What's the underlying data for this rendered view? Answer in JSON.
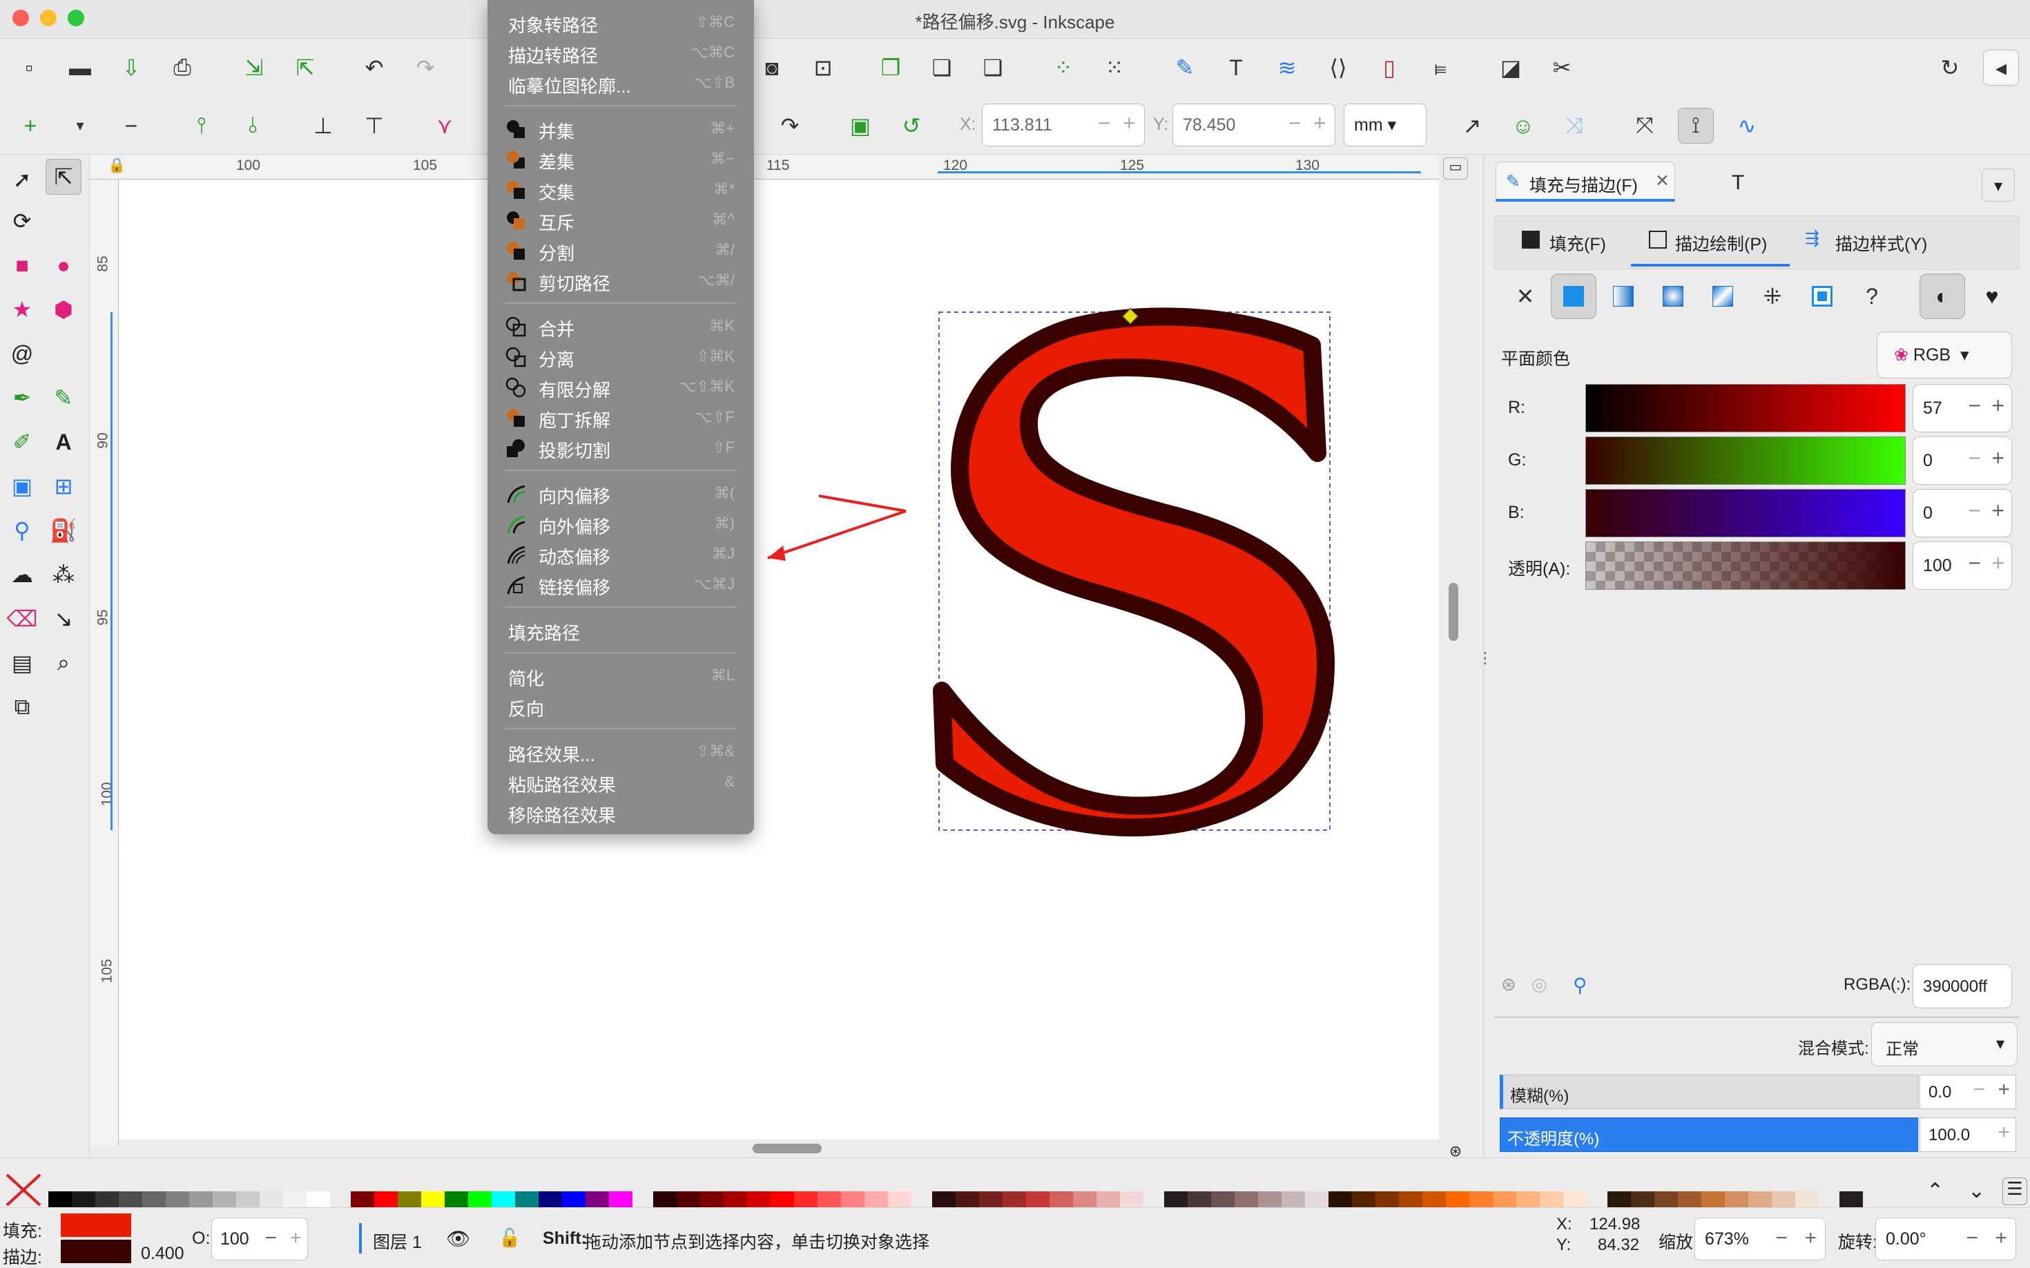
{
  "window": {
    "title": "*路径偏移.svg - Inkscape"
  },
  "toolbar": {
    "x_label": "X:",
    "x_value": "113.811",
    "y_label": "Y:",
    "y_value": "78.450",
    "unit": "mm"
  },
  "ruler": {
    "top_ticks": [
      "100",
      "105",
      "115",
      "120",
      "125",
      "130"
    ],
    "left_ticks": [
      "85",
      "90",
      "95",
      "100",
      "105"
    ]
  },
  "menu": {
    "items": [
      {
        "label": "对象转路径",
        "shortcut": "⇧⌘C"
      },
      {
        "label": "描边转路径",
        "shortcut": "⌥⌘C"
      },
      {
        "label": "临摹位图轮廓...",
        "shortcut": "⌥⇧B"
      },
      {
        "label": "并集",
        "shortcut": "⌘+"
      },
      {
        "label": "差集",
        "shortcut": "⌘−"
      },
      {
        "label": "交集",
        "shortcut": "⌘*"
      },
      {
        "label": "互斥",
        "shortcut": "⌘^"
      },
      {
        "label": "分割",
        "shortcut": "⌘/"
      },
      {
        "label": "剪切路径",
        "shortcut": "⌥⌘/"
      },
      {
        "label": "合并",
        "shortcut": "⌘K"
      },
      {
        "label": "分离",
        "shortcut": "⇧⌘K"
      },
      {
        "label": "有限分解",
        "shortcut": "⌥⇧⌘K"
      },
      {
        "label": "庖丁拆解",
        "shortcut": "⌥⇧F"
      },
      {
        "label": "投影切割",
        "shortcut": "⇧F"
      },
      {
        "label": "向内偏移",
        "shortcut": "⌘("
      },
      {
        "label": "向外偏移",
        "shortcut": "⌘)"
      },
      {
        "label": "动态偏移",
        "shortcut": "⌘J"
      },
      {
        "label": "链接偏移",
        "shortcut": "⌥⌘J"
      },
      {
        "label": "填充路径",
        "shortcut": ""
      },
      {
        "label": "简化",
        "shortcut": "⌘L"
      },
      {
        "label": "反向",
        "shortcut": ""
      },
      {
        "label": "路径效果...",
        "shortcut": "⇧⌘&"
      },
      {
        "label": "粘贴路径效果",
        "shortcut": "&"
      },
      {
        "label": "移除路径效果",
        "shortcut": ""
      }
    ]
  },
  "panel": {
    "tab_fill_stroke": "填充与描边(F)",
    "tab_text": "T",
    "subtab_fill": "填充(F)",
    "subtab_stroke_paint": "描边绘制(P)",
    "subtab_stroke_style": "描边样式(Y)",
    "flat_color_label": "平面颜色",
    "color_mode": "RGB",
    "r_label": "R:",
    "r_value": "57",
    "g_label": "G:",
    "g_value": "0",
    "b_label": "B:",
    "b_value": "0",
    "a_label": "透明(A):",
    "a_value": "100",
    "rgba_label": "RGBA(:):",
    "rgba_value": "390000ff",
    "blend_label": "混合模式:",
    "blend_value": "正常",
    "blur_label": "模糊(%)",
    "blur_value": "0.0",
    "opacity_label": "不透明度(%)",
    "opacity_value": "100.0"
  },
  "status": {
    "fill_label": "填充:",
    "stroke_label": "描边:",
    "stroke_width": "0.400",
    "o_label": "O:",
    "o_value": "100",
    "layer": "图层 1",
    "hint_key": "Shift:",
    "hint": "拖动添加节点到选择内容，单击切换对象选择",
    "x_label": "X:",
    "x_value": "124.98",
    "y_label": "Y:",
    "y_value": "84.32",
    "zoom_label": "缩放:",
    "zoom_value": "673%",
    "rotate_label": "旋转:",
    "rotate_value": "0.00°"
  },
  "colors": {
    "fill": "#e81c00",
    "stroke": "#390000",
    "accent": "#2a7ff0",
    "selection": "#3b8fe0"
  },
  "palette": [
    "#000000",
    "#1a1a1a",
    "#333333",
    "#4d4d4d",
    "#666666",
    "#808080",
    "#999999",
    "#b3b3b3",
    "#cccccc",
    "#e6e6e6",
    "#f2f2f2",
    "#ffffff",
    "#800000",
    "#ff0000",
    "#808000",
    "#ffff00",
    "#008000",
    "#00ff00",
    "#00ffff",
    "#008080",
    "#000080",
    "#0000ff",
    "#800080",
    "#ff00ff",
    "#2b0000",
    "#550000",
    "#800000",
    "#aa0000",
    "#d40000",
    "#ff0000",
    "#ff2a2a",
    "#ff5555",
    "#ff8080",
    "#ffaaaa",
    "#ffd5d5",
    "#280b0b",
    "#501616",
    "#782121",
    "#a02c2c",
    "#c83737",
    "#d35f5f",
    "#de8787",
    "#e9afaf",
    "#f4d7d7",
    "#241c1c",
    "#483737",
    "#6c5353",
    "#916f6f",
    "#ac9393",
    "#c8b7b7",
    "#e3dbdb",
    "#2b1100",
    "#552200",
    "#803300",
    "#aa4400",
    "#d45500",
    "#ff6600",
    "#ff7f2a",
    "#ff9955",
    "#ffb380",
    "#ffccaa",
    "#ffe6d5",
    "#28170b",
    "#502d16",
    "#784421",
    "#a05a2c",
    "#c87137",
    "#d38d5f",
    "#deaa87",
    "#e9c6af",
    "#f4e3d7",
    "#241f1c"
  ]
}
